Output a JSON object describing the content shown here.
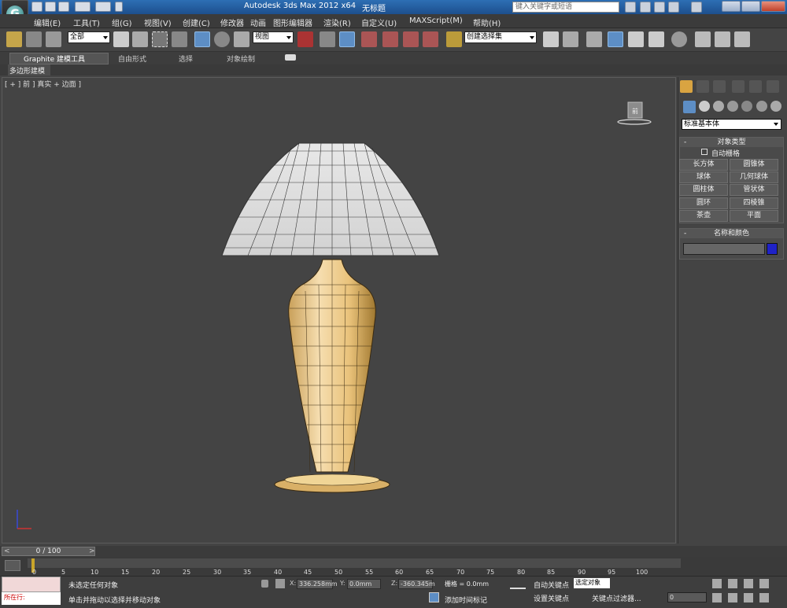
{
  "titlebar": {
    "title": "Autodesk 3ds Max  2012 x64",
    "file": "无标题",
    "search_placeholder": "键入关键字或短语"
  },
  "menu": [
    "编辑(E)",
    "工具(T)",
    "组(G)",
    "视图(V)",
    "创建(C)",
    "修改器",
    "动画",
    "图形编辑器",
    "渲染(R)",
    "自定义(U)",
    "MAXScript(M)",
    "帮助(H)"
  ],
  "toolbar": {
    "selection_filter": "全部",
    "ref_coord": "视图",
    "named_selection": "创建选择集"
  },
  "ribbon": {
    "tabs": [
      "Graphite 建模工具",
      "自由形式",
      "选择",
      "对象绘制"
    ],
    "subtab": "多边形建模"
  },
  "viewport": {
    "label": "[ + ] 前 ] 真实 + 边面 ]",
    "viewcube_face": "前"
  },
  "command_panel": {
    "dropdown": "标准基本体",
    "object_type": {
      "title": "对象类型",
      "autogrid": "自动栅格",
      "buttons": [
        "长方体",
        "圆锥体",
        "球体",
        "几何球体",
        "圆柱体",
        "管状体",
        "圆环",
        "四棱锥",
        "茶壶",
        "平面"
      ]
    },
    "name_color": {
      "title": "名称和颜色",
      "swatch_color": "#1f22c7"
    }
  },
  "timeline": {
    "slider": "0 / 100",
    "ticks": [
      "0",
      "5",
      "10",
      "15",
      "20",
      "25",
      "30",
      "35",
      "40",
      "45",
      "50",
      "55",
      "60",
      "65",
      "70",
      "75",
      "80",
      "85",
      "90",
      "95",
      "100"
    ]
  },
  "status": {
    "maxscript": "所在行:",
    "message1": "未选定任何对象",
    "message2": "单击并拖动以选择并移动对象",
    "x_label": "X:",
    "x_value": "336.258mm",
    "y_label": "Y:",
    "y_value": "0.0mm",
    "z_label": "Z:",
    "z_value": "-360.345m",
    "grid": "栅格 = 0.0mm",
    "add_time_tag": "添加时间标记",
    "auto_key": "自动关键点",
    "set_key": "设置关键点",
    "selected_object": "选定对象",
    "key_filters": "关键点过滤器...",
    "frame": "0"
  }
}
